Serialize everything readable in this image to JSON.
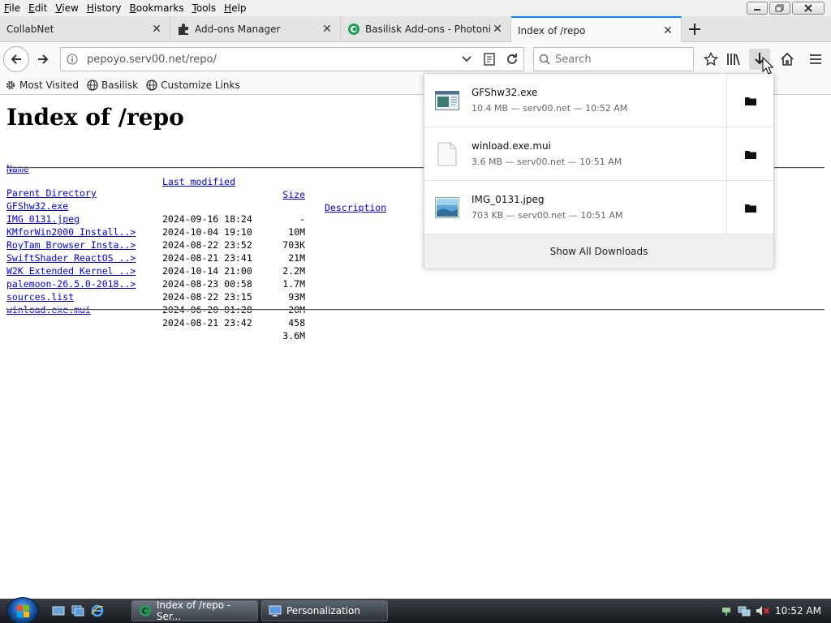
{
  "menubar": {
    "items": [
      "File",
      "Edit",
      "View",
      "History",
      "Bookmarks",
      "Tools",
      "Help"
    ]
  },
  "tabs": [
    {
      "title": "CollabNet",
      "icon": "none"
    },
    {
      "title": "Add-ons Manager",
      "icon": "puzzle-icon"
    },
    {
      "title": "Basilisk Add-ons - Photonic",
      "icon": "basilisk-icon"
    },
    {
      "title": "Index of /repo",
      "icon": "none",
      "active": true
    }
  ],
  "navbar": {
    "url": "pepoyo.serv00.net/repo/",
    "search_placeholder": "Search"
  },
  "bookmarks": [
    "Most Visited",
    "Basilisk",
    "Customize Links"
  ],
  "page": {
    "title": "Index of /repo",
    "headers": {
      "name": "Name",
      "modified": "Last modified",
      "size": "Size",
      "description": "Description"
    },
    "rows": [
      {
        "name": "Parent Directory",
        "modified": "",
        "size": "-"
      },
      {
        "name": "GFShw32.exe",
        "modified": "2024-09-16 18:24",
        "size": "10M"
      },
      {
        "name": "IMG 0131.jpeg",
        "modified": "2024-10-04 19:10",
        "size": "703K"
      },
      {
        "name": "KMforWin2000 Install..>",
        "modified": "2024-08-22 23:52",
        "size": "21M"
      },
      {
        "name": "RoyTam Browser Insta..>",
        "modified": "2024-08-21 23:41",
        "size": "2.2M"
      },
      {
        "name": "SwiftShader ReactOS ..>",
        "modified": "2024-10-14 21:00",
        "size": "1.7M"
      },
      {
        "name": "W2K Extended Kernel ..>",
        "modified": "2024-08-23 00:58",
        "size": "93M"
      },
      {
        "name": "palemoon-26.5.0-2018..>",
        "modified": "2024-08-22 23:15",
        "size": "20M"
      },
      {
        "name": "sources.list",
        "modified": "2024-06-20 01:28",
        "size": "458"
      },
      {
        "name": "winload.exe.mui",
        "modified": "2024-08-21 23:42",
        "size": "3.6M"
      }
    ]
  },
  "downloads": {
    "items": [
      {
        "name": "GFShw32.exe",
        "meta": "10.4 MB — serv00.net — 10:52 AM",
        "icon": "exe-file-icon"
      },
      {
        "name": "winload.exe.mui",
        "meta": "3.6 MB — serv00.net — 10:51 AM",
        "icon": "blank-file-icon"
      },
      {
        "name": "IMG_0131.jpeg",
        "meta": "703 KB — serv00.net — 10:51 AM",
        "icon": "image-file-icon"
      }
    ],
    "show_all": "Show All Downloads"
  },
  "taskbar": {
    "tasks": [
      {
        "label": "Index of /repo - Ser...",
        "active": true
      },
      {
        "label": "Personalization",
        "active": false
      }
    ],
    "clock": "10:52 AM"
  },
  "colors": {
    "accent": "#0a84ff",
    "link": "#0000ee"
  }
}
